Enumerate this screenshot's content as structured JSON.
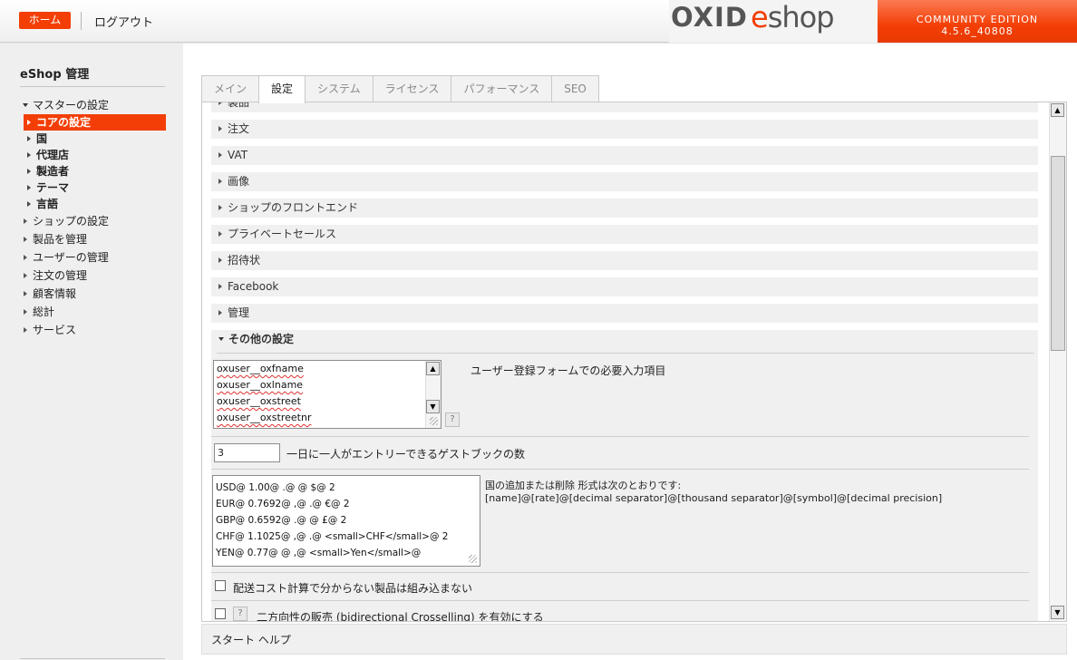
{
  "header": {
    "home_label": "ホーム",
    "logout_label": "ログアウト",
    "logo_oxid": "OXID",
    "logo_e": "e",
    "logo_shop": "shop",
    "edition_line1": "COMMUNITY EDITION",
    "edition_line2": "4.5.6_40808"
  },
  "sidebar": {
    "title": "eShop 管理",
    "master": "マスターの設定",
    "sub_items": [
      "コアの設定",
      "国",
      "代理店",
      "製造者",
      "テーマ",
      "言語"
    ],
    "items": [
      "ショップの設定",
      "製品を管理",
      "ユーザーの管理",
      "注文の管理",
      "顧客情報",
      "総計",
      "サービス"
    ]
  },
  "tabs": [
    "メイン",
    "設定",
    "システム",
    "ライセンス",
    "パフォーマンス",
    "SEO"
  ],
  "groups": [
    "製品",
    "注文",
    "VAT",
    "画像",
    "ショップのフロントエンド",
    "プライベートセールス",
    "招待状",
    "Facebook",
    "管理",
    "その他の設定"
  ],
  "settings": {
    "required_fields": [
      "oxuser__oxfname",
      "oxuser__oxlname",
      "oxuser__oxstreet",
      "oxuser__oxstreetnr"
    ],
    "required_fields_label": "ユーザー登録フォームでの必要入力項目",
    "help_mark": "?",
    "guestbook_value": "3",
    "guestbook_label": "一日に一人がエントリーできるゲストブックの数",
    "currencies": [
      "USD@ 1.00@ .@  @ $@ 2",
      "EUR@ 0.7692@ ,@ .@ €@ 2",
      "GBP@ 0.6592@ .@  @ £@ 2",
      "CHF@ 1.1025@ ,@ .@ <small>CHF</small>@ 2",
      "YEN@ 0.77@ @ ,@ <small>Yen</small>@"
    ],
    "currency_label_1": "国の追加または削除 形式は次のとおりです:",
    "currency_label_2": "[name]@[rate]@[decimal separator]@[thousand separator]@[symbol]@[decimal precision]",
    "shipping_checkbox_label": "配送コスト計算で分からない製品は組み込まない",
    "crossselling_label": "二方向性の販売 (bidirectional Crosselling) を有効にする"
  },
  "footer": {
    "help_label": "スタート ヘルプ"
  }
}
